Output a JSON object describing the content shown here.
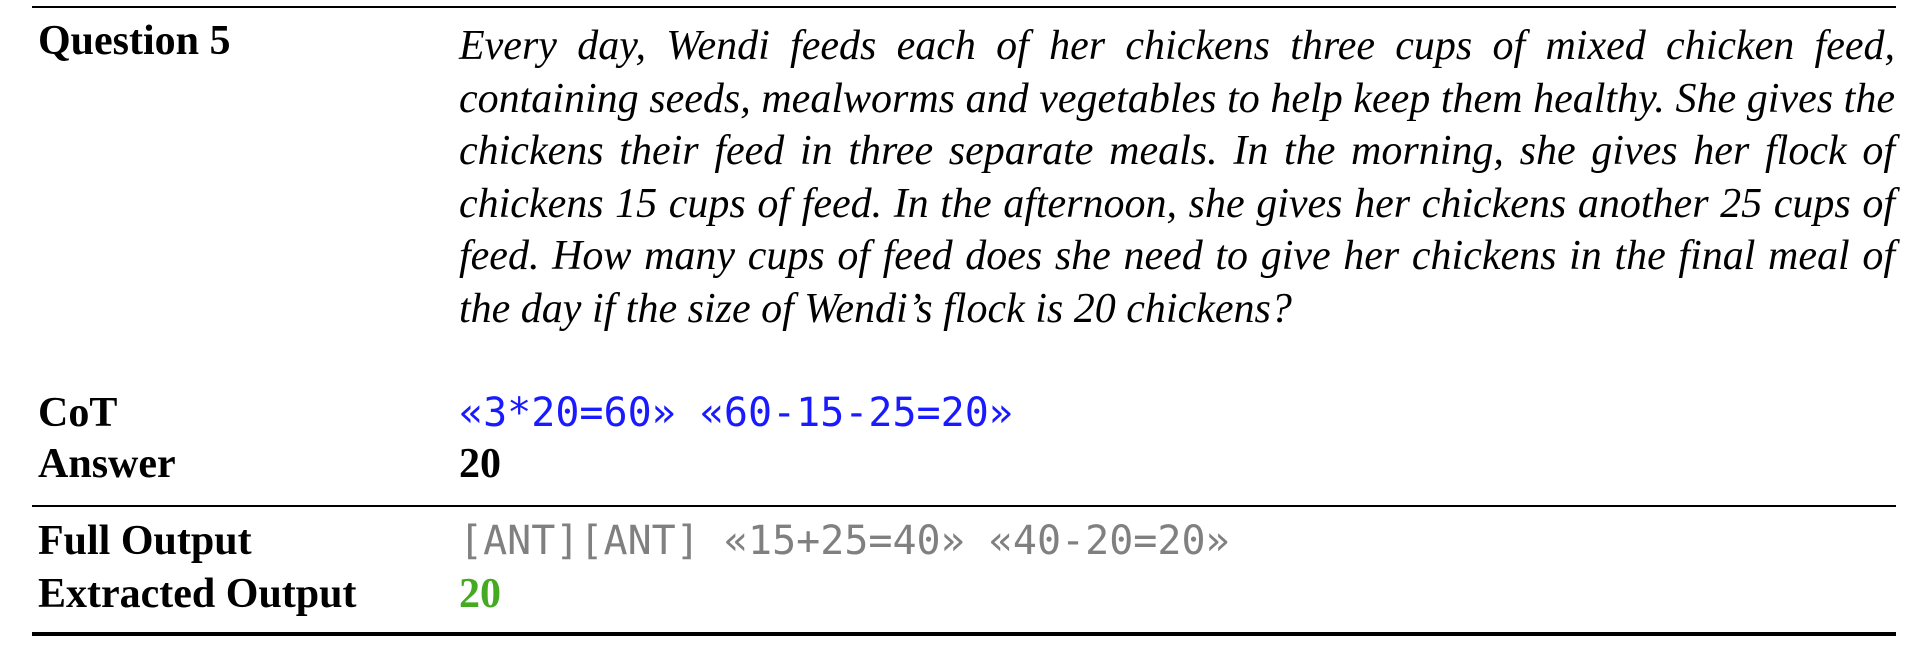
{
  "question": {
    "label": "Question 5",
    "text": "Every day, Wendi feeds each of her chickens three cups of mixed chicken feed, containing seeds, mealworms and vegetables to help keep them healthy. She gives the chickens their feed in three separate meals. In the morning, she gives her flock of chickens 15 cups of feed. In the afternoon, she gives her chickens another 25 cups of feed. How many cups of feed does she need to give her chickens in the final meal of the day if the size of Wendi’s flock is 20 chickens?"
  },
  "cot": {
    "label": "CoT",
    "value": "«3*20=60» «60-15-25=20»"
  },
  "answer": {
    "label": "Answer",
    "value": "20"
  },
  "full_output": {
    "label": "Full Output",
    "value": "[ANT][ANT] «15+25=40» «40-20=20»"
  },
  "extracted_output": {
    "label": "Extracted Output",
    "value": "20"
  },
  "colors": {
    "cot": "#1a1aff",
    "full_output": "#808080",
    "extracted_output": "#44aa22"
  }
}
